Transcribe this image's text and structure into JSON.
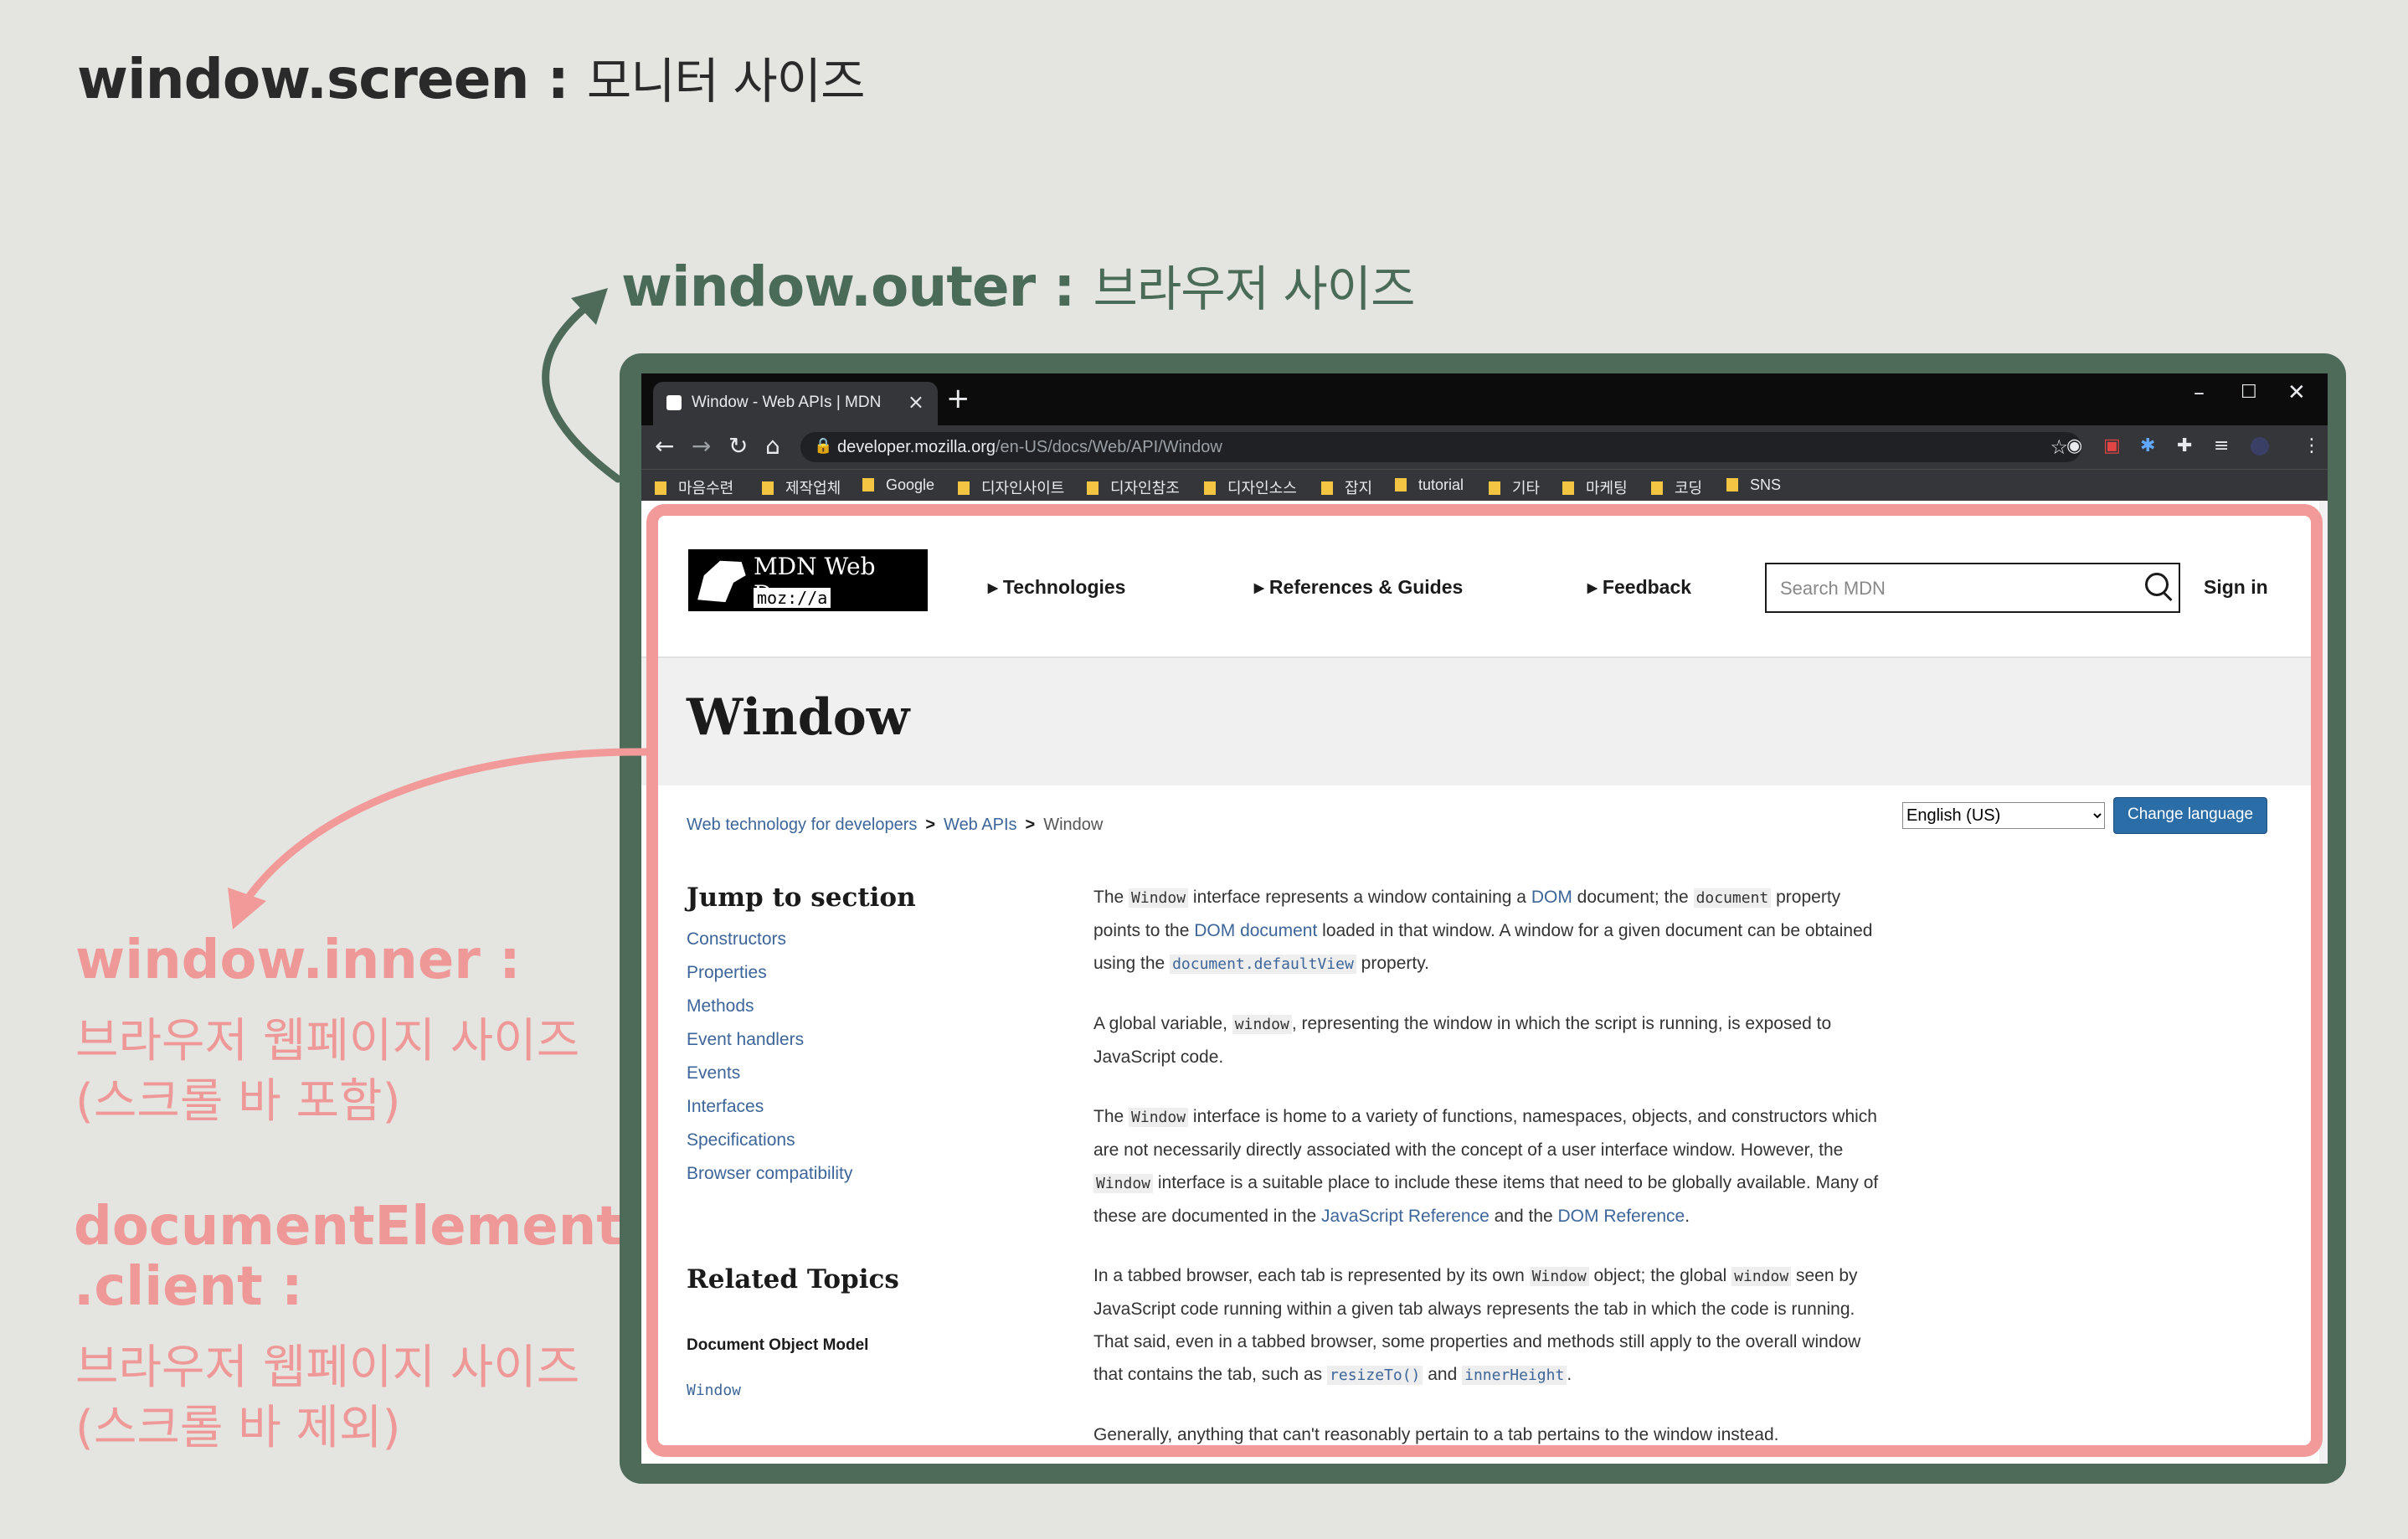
{
  "labels": {
    "screen": {
      "prop": "window.screen",
      "sep": " : ",
      "desc": "모니터 사이즈"
    },
    "outer": {
      "prop": "window.outer",
      "sep": " : ",
      "desc": "브라우저 사이즈"
    },
    "inner": {
      "prop": "window.inner :",
      "line1": "브라우저 웹페이지 사이즈",
      "line2": "(스크롤 바 포함)"
    },
    "client": {
      "prop1": "documentElement",
      "prop2": ".client :",
      "line1": "브라우저 웹페이지 사이즈",
      "line2": "(스크롤 바 제외)"
    }
  },
  "colors": {
    "outer_frame": "#4e6b5a",
    "inner_box": "#f29a9a",
    "background": "#e4e4e0"
  },
  "browser": {
    "tab_title": "Window - Web APIs | MDN",
    "tab_close": "×",
    "new_tab": "+",
    "window_controls": [
      "–",
      "☐",
      "✕"
    ],
    "nav": {
      "back": "←",
      "forward": "→",
      "reload": "↻",
      "home": "⌂"
    },
    "url_host": "developer.mozilla.org",
    "url_path": "/en-US/docs/Web/API/Window",
    "bookmarks": [
      "마음수련",
      "제작업체",
      "Google",
      "디자인사이트",
      "디자인참조",
      "디자인소스",
      "잡지",
      "tutorial",
      "기타",
      "마케팅",
      "코딩",
      "SNS"
    ]
  },
  "site": {
    "logo_title": "MDN Web Docs",
    "logo_sub": "moz://a",
    "nav": [
      "▸ Technologies",
      "▸ References & Guides",
      "▸ Feedback"
    ],
    "search_placeholder": "Search MDN",
    "sign_in": "Sign in",
    "page_title": "Window",
    "breadcrumb": [
      "Web technology for developers",
      "Web APIs",
      "Window"
    ],
    "breadcrumb_sep": ">",
    "language": "English (US)",
    "change_language": "Change language",
    "jump_heading": "Jump to section",
    "jump_links": [
      "Constructors",
      "Properties",
      "Methods",
      "Event handlers",
      "Events",
      "Interfaces",
      "Specifications",
      "Browser compatibility"
    ],
    "related_heading": "Related Topics",
    "related_item": "Document Object Model",
    "related_sub": "Window"
  },
  "article": {
    "p1": {
      "a": "The ",
      "c1": "Window",
      "b": " interface represents a window containing a ",
      "l1": "DOM",
      "c": " document; the ",
      "c2": "document",
      "d": " property points to the ",
      "l2": "DOM document",
      "e": " loaded in that window. A window for a given document can be obtained using the ",
      "c3": "document.defaultView",
      "f": " property."
    },
    "p2": {
      "a": "A global variable, ",
      "c1": "window",
      "b": ", representing the window in which the script is running, is exposed to JavaScript code."
    },
    "p3": {
      "a": "The ",
      "c1": "Window",
      "b": " interface is home to a variety of functions, namespaces, objects, and constructors which are not necessarily directly associated with the concept of a user interface window. However, the ",
      "c2": "Window",
      "c": " interface is a suitable place to include these items that need to be globally available. Many of these are documented in the ",
      "l1": "JavaScript Reference",
      "d": " and the ",
      "l2": "DOM Reference",
      "e": "."
    },
    "p4": {
      "a": "In a tabbed browser, each tab is represented by its own ",
      "c1": "Window",
      "b": " object; the global ",
      "c2": "window",
      "c": " seen by JavaScript code running within a given tab always represents the tab in which the code is running. That said, even in a tabbed browser, some properties and methods still apply to the overall window that contains the tab, such as ",
      "c3": "resizeTo()",
      "d": " and ",
      "c4": "innerHeight",
      "e": "."
    },
    "p5": "Generally, anything that can't reasonably pertain to a tab pertains to the window instead."
  }
}
